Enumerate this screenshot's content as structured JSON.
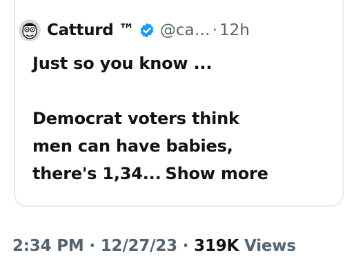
{
  "tweet": {
    "author_name": "Catturd ™",
    "handle": "@ca…",
    "separator": "·",
    "time_ago": "12h",
    "text_line1": "Just so you know ...",
    "text_line2": "Democrat voters think",
    "text_line3": "men can have babies,",
    "text_line4": "there's 1,34...",
    "show_more_label": "Show more"
  },
  "meta": {
    "time": "2:34 PM",
    "separator1": "·",
    "date": "12/27/23",
    "separator2": "·",
    "views_count": "319K",
    "views_label": "Views"
  },
  "icons": {
    "avatar": "cartoon-avatar-icon",
    "verified": "verified-badge-icon"
  },
  "colors": {
    "verified_blue": "#1d9bf0",
    "secondary_text": "#536471",
    "primary_text": "#0f1419",
    "border": "#e7e9ec"
  }
}
